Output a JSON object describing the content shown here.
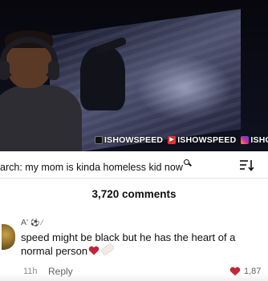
{
  "video": {
    "watermark": [
      "ISHOWSPEED",
      "ISHOWSPEED",
      "ISHOWSPEE"
    ]
  },
  "search": {
    "query": "arch: my mom is kinda homeless kid now"
  },
  "comments_header": {
    "count_label": "3,720 comments"
  },
  "comment": {
    "author": "A'",
    "body": "speed might be black but he has the heart of a normal person",
    "timestamp": "11h",
    "reply_label": "Reply",
    "like_count": "1,87"
  },
  "icons": {
    "search": "search-icon",
    "sort": "sort-icon",
    "heart": "heart-icon",
    "bandage": "bandage-emoji-icon"
  },
  "colors": {
    "heart": "#c0263a",
    "background": "#ffffff",
    "text": "#0f0f0f",
    "secondary_text": "#606060"
  }
}
